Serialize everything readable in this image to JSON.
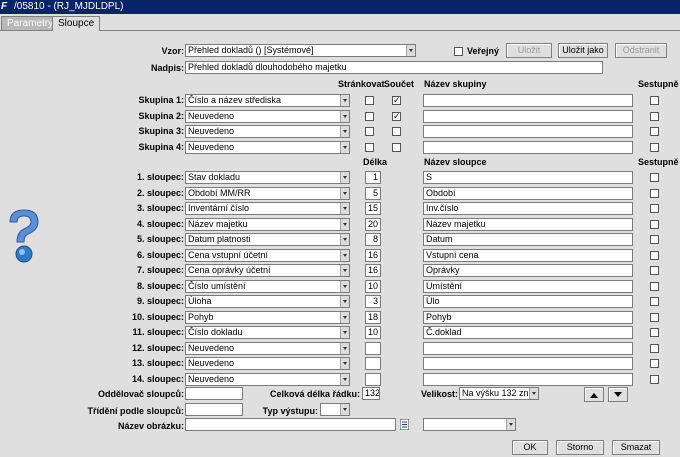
{
  "window": {
    "title": "/05810 - (RJ_MJDLDPL)",
    "logo": "F"
  },
  "tabs": [
    {
      "label": "Parametry",
      "active": false
    },
    {
      "label": "Sloupce",
      "active": true
    }
  ],
  "top": {
    "vzor_label": "Vzor:",
    "vzor_value": "Přehled dokladů  ()  [Systémové]",
    "verejny_label": "Veřejný",
    "verejny_checked": false,
    "ulozit": "Uložit",
    "ulozit_jako": "Uložit jako",
    "odstranit": "Odstranit",
    "nadpis_label": "Nadpis:",
    "nadpis_value": "Přehled dokladů dlouhodobého majetku"
  },
  "group_headers": {
    "strankovat": "Stránkovat",
    "soucet": "Součet",
    "nazev_skupiny": "Název skupiny",
    "sestupne": "Sestupně"
  },
  "groups": [
    {
      "label": "Skupina 1:",
      "value": "Číslo a název střediska",
      "strankovat": false,
      "soucet": true,
      "name": "",
      "sestupne": false
    },
    {
      "label": "Skupina 2:",
      "value": "Neuvedeno",
      "strankovat": false,
      "soucet": true,
      "name": "",
      "sestupne": false
    },
    {
      "label": "Skupina 3:",
      "value": "Neuvedeno",
      "strankovat": false,
      "soucet": false,
      "name": "",
      "sestupne": false
    },
    {
      "label": "Skupina 4:",
      "value": "Neuvedeno",
      "strankovat": false,
      "soucet": false,
      "name": "",
      "sestupne": false
    }
  ],
  "col_headers": {
    "delka": "Délka",
    "nazev_sloupce": "Název sloupce",
    "sestupne": "Sestupně"
  },
  "columns": [
    {
      "label": "1. sloupec:",
      "value": "Stav dokladu",
      "delka": "1",
      "name": "S"
    },
    {
      "label": "2. sloupec:",
      "value": "Období MM/RR",
      "delka": "5",
      "name": "Období"
    },
    {
      "label": "3. sloupec:",
      "value": "Inventární číslo",
      "delka": "15",
      "name": "Inv.číslo"
    },
    {
      "label": "4. sloupec:",
      "value": "Název majetku",
      "delka": "20",
      "name": "Název majetku"
    },
    {
      "label": "5. sloupec:",
      "value": "Datum platnosti",
      "delka": "8",
      "name": "Datum"
    },
    {
      "label": "6. sloupec:",
      "value": "Cena vstupní účetní",
      "delka": "16",
      "name": "Vstupní cena"
    },
    {
      "label": "7. sloupec:",
      "value": "Cena oprávky účetní",
      "delka": "16",
      "name": "Oprávky"
    },
    {
      "label": "8. sloupec:",
      "value": "Číslo umístění",
      "delka": "10",
      "name": "Umístění"
    },
    {
      "label": "9. sloupec:",
      "value": "Úloha",
      "delka": "3",
      "name": "Úlo"
    },
    {
      "label": "10. sloupec:",
      "value": "Pohyb",
      "delka": "18",
      "name": "Pohyb"
    },
    {
      "label": "11. sloupec:",
      "value": "Číslo dokladu",
      "delka": "10",
      "name": "Č.doklad"
    },
    {
      "label": "12. sloupec:",
      "value": "Neuvedeno",
      "delka": "",
      "name": ""
    },
    {
      "label": "13. sloupec:",
      "value": "Neuvedeno",
      "delka": "",
      "name": ""
    },
    {
      "label": "14. sloupec:",
      "value": "Neuvedeno",
      "delka": "",
      "name": ""
    }
  ],
  "bottom": {
    "oddelovac_label": "Oddělovač sloupců:",
    "oddelovac_value": "",
    "celkova_label": "Celková délka řádku:",
    "celkova_value": "132",
    "velikost_label": "Velikost:",
    "velikost_value": "Na výšku 132 zn.",
    "trideni_label": "Třídění podle sloupců:",
    "trideni_value": "",
    "typ_label": "Typ výstupu:",
    "typ_value": "",
    "obrazek_label": "Název obrázku:",
    "obrazek_value": "",
    "obrazek_combo": ""
  },
  "buttons": {
    "ok": "OK",
    "storno": "Storno",
    "smazat": "Smazat"
  },
  "icons": {
    "logo": "app-logo-icon",
    "help": "help-question-icon",
    "up": "arrow-up-icon",
    "down": "arrow-down-icon",
    "list": "list-icon"
  },
  "colors": {
    "titlebar": "#0a246a",
    "background": "#dfdfdf"
  }
}
